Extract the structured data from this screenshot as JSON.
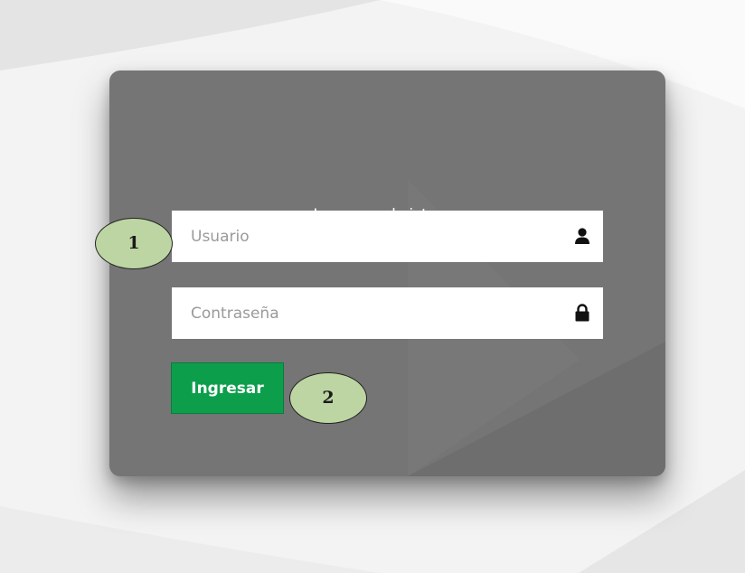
{
  "login": {
    "title": "Ingresar al sistema",
    "username": {
      "placeholder": "Usuario",
      "value": "",
      "icon": "user-icon"
    },
    "password": {
      "placeholder": "Contraseña",
      "value": "",
      "icon": "lock-icon"
    },
    "submit_label": "Ingresar"
  },
  "callouts": {
    "first": "1",
    "second": "2"
  },
  "colors": {
    "panel": "#757575",
    "button": "#0d9e4c",
    "callout": "#bdd5a3",
    "background": "#f2f2f2"
  }
}
